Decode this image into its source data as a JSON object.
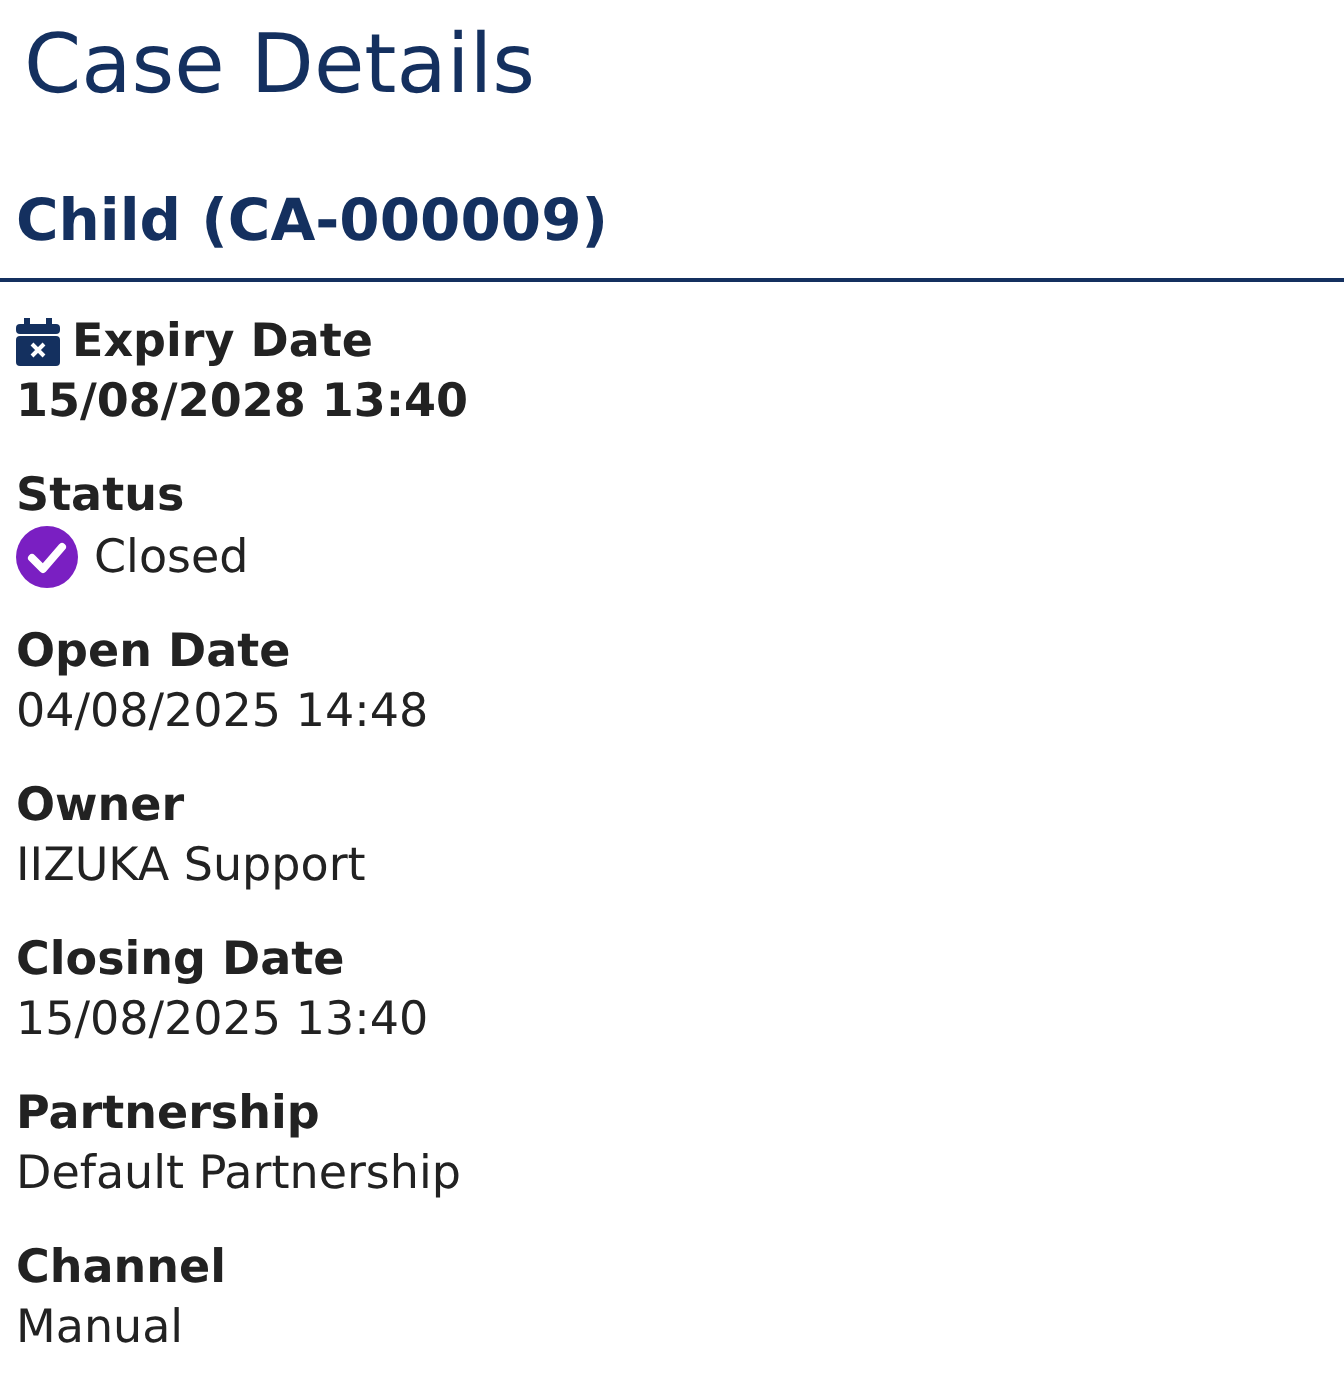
{
  "title": "Case Details",
  "case_heading": "Child (CA-000009)",
  "fields": [
    {
      "kind": "expiry",
      "label": "Expiry Date",
      "value": "15/08/2028 13:40"
    },
    {
      "kind": "status",
      "label": "Status",
      "value": "Closed",
      "color": "#7a1fc2"
    },
    {
      "kind": "plain",
      "label": "Open Date",
      "value": "04/08/2025 14:48"
    },
    {
      "kind": "plain",
      "label": "Owner",
      "value": "IIZUKA Support"
    },
    {
      "kind": "plain",
      "label": "Closing Date",
      "value": "15/08/2025 13:40"
    },
    {
      "kind": "plain",
      "label": "Partnership",
      "value": "Default Partnership"
    },
    {
      "kind": "plain",
      "label": "Channel",
      "value": "Manual"
    }
  ]
}
